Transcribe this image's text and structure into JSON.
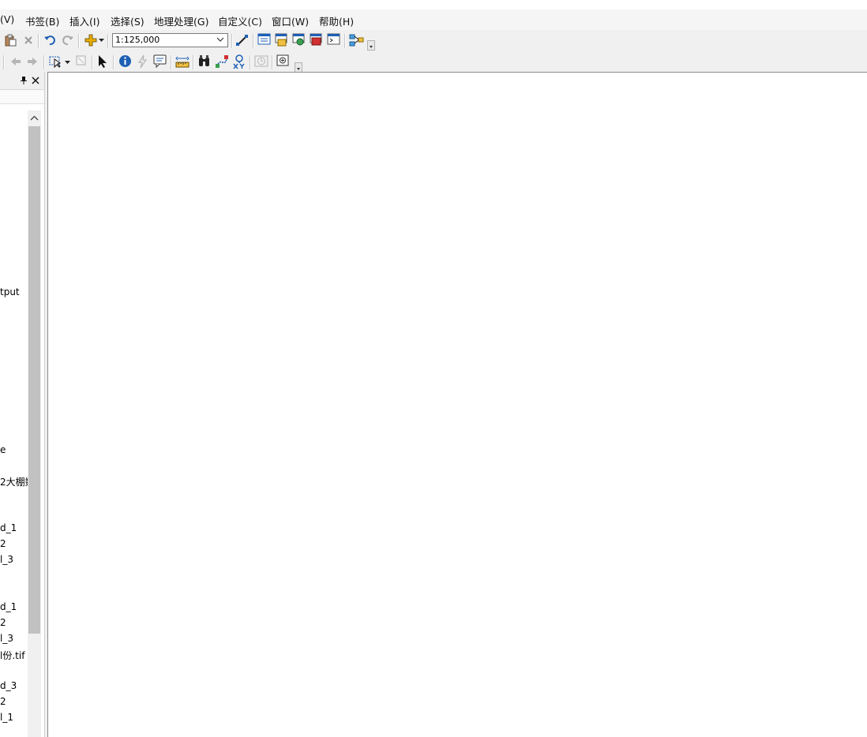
{
  "menu": {
    "items": [
      {
        "label": "(V)"
      },
      {
        "label": "书签(B)"
      },
      {
        "label": "插入(I)"
      },
      {
        "label": "选择(S)"
      },
      {
        "label": "地理处理(G)"
      },
      {
        "label": "自定义(C)"
      },
      {
        "label": "窗口(W)"
      },
      {
        "label": "帮助(H)"
      }
    ]
  },
  "toolbar": {
    "scale_value": "1:125,000"
  },
  "toc": {
    "items": [
      {
        "label": "tput"
      },
      {
        "label": "e"
      },
      {
        "label": "2大棚数"
      },
      {
        "label": "d_1"
      },
      {
        "label": "2"
      },
      {
        "label": "l_3"
      },
      {
        "label": "d_1"
      },
      {
        "label": "2"
      },
      {
        "label": "l_3"
      },
      {
        "label": "l份.tif"
      },
      {
        "label": "d_3"
      },
      {
        "label": "2"
      },
      {
        "label": "l_1"
      }
    ]
  },
  "colors": {
    "accent_blue": "#1e5fb4",
    "map_background": "#ffffff"
  }
}
